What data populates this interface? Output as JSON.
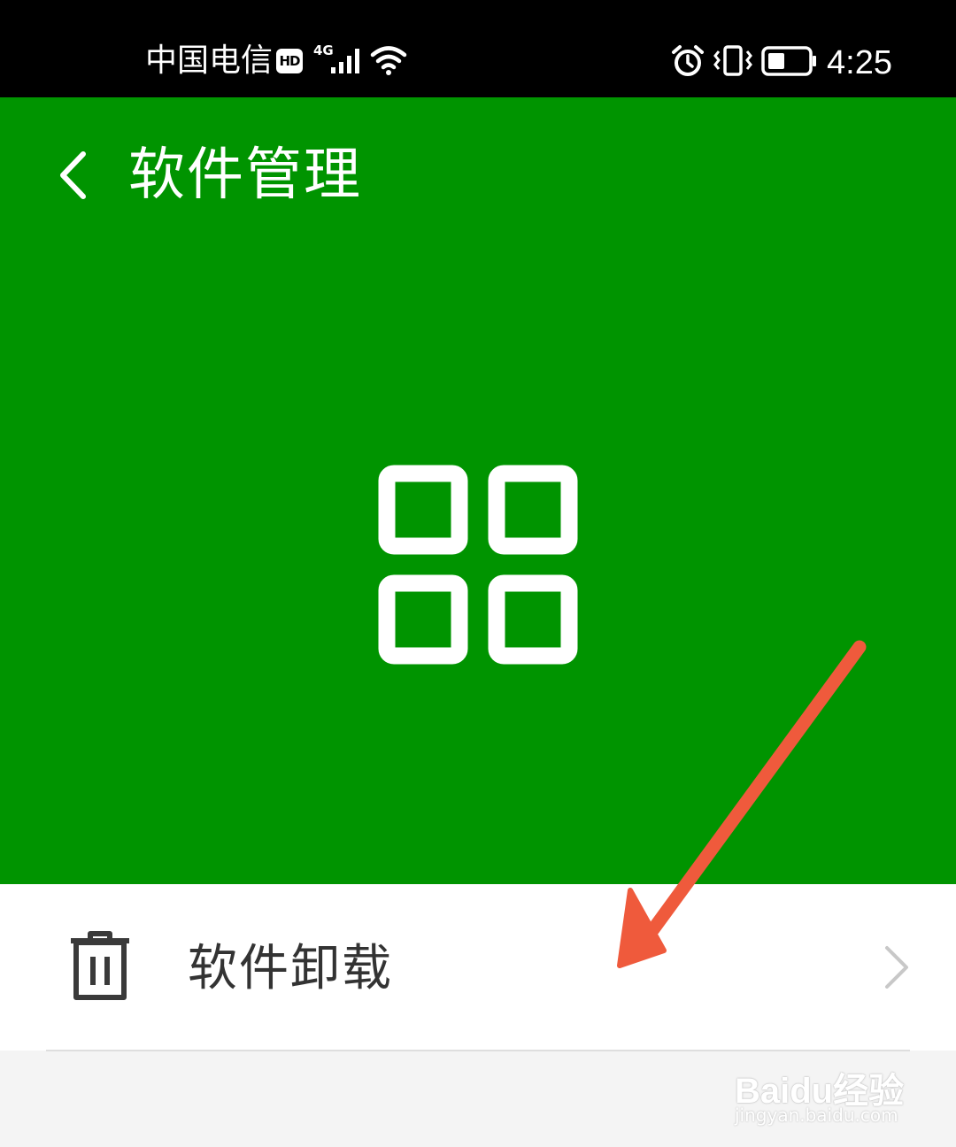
{
  "status_bar": {
    "carrier": "中国电信",
    "hd_badge": "HD",
    "network_type": "4G",
    "time": "4:25",
    "icons": [
      "hd-badge-icon",
      "signal-icon",
      "wifi-icon",
      "alarm-icon",
      "vibrate-icon",
      "battery-icon"
    ]
  },
  "header": {
    "title": "软件管理",
    "background_color": "#009400",
    "back_icon": "chevron-left-icon",
    "hero_icon": "apps-grid-icon"
  },
  "list": {
    "items": [
      {
        "label": "软件卸载",
        "icon": "trash-icon",
        "trailing_icon": "chevron-right-icon"
      }
    ]
  },
  "annotation": {
    "arrow_color": "#ef5a3c"
  },
  "watermark": {
    "brand": "Baidu经验",
    "url": "jingyan.baidu.com"
  }
}
